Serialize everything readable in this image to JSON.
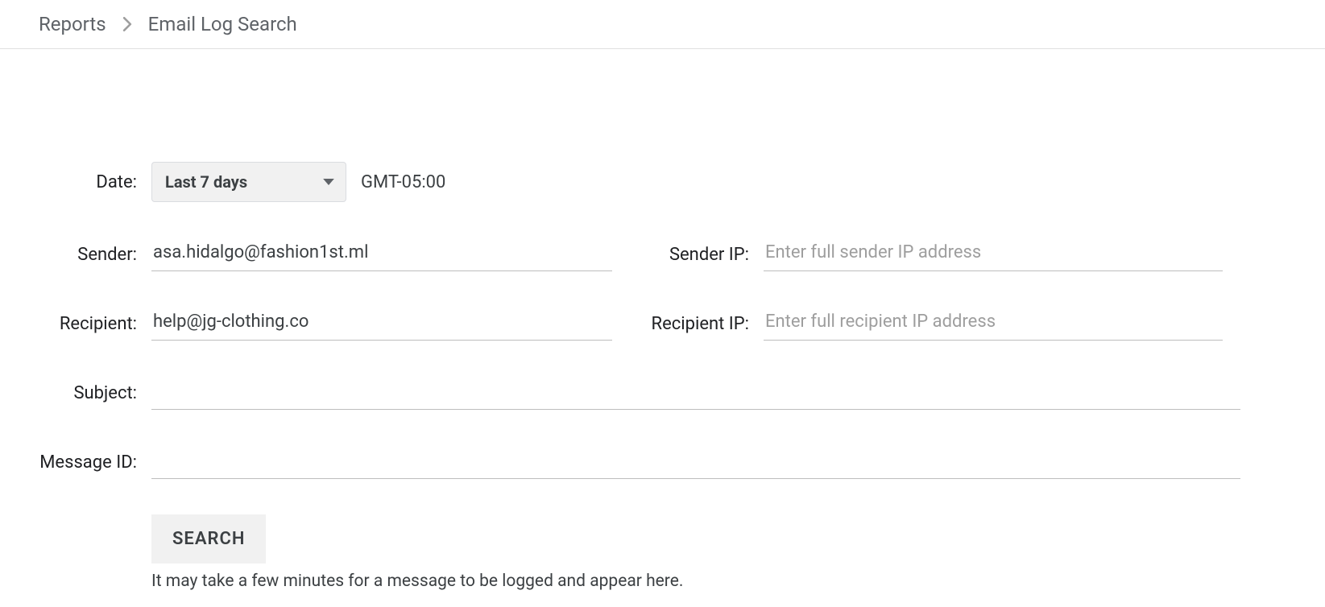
{
  "breadcrumb": {
    "parent": "Reports",
    "current": "Email Log Search"
  },
  "form": {
    "date": {
      "label": "Date:",
      "selected": "Last 7 days",
      "tz": "GMT-05:00"
    },
    "sender": {
      "label": "Sender:",
      "value": "asa.hidalgo@fashion1st.ml"
    },
    "sender_ip": {
      "label": "Sender IP:",
      "value": "",
      "placeholder": "Enter full sender IP address"
    },
    "recipient": {
      "label": "Recipient:",
      "value": "help@jg-clothing.co"
    },
    "recipient_ip": {
      "label": "Recipient IP:",
      "value": "",
      "placeholder": "Enter full recipient IP address"
    },
    "subject": {
      "label": "Subject:",
      "value": ""
    },
    "message_id": {
      "label": "Message ID:",
      "value": ""
    },
    "search_btn": "SEARCH",
    "hint": "It may take a few minutes for a message to be logged and appear here."
  }
}
